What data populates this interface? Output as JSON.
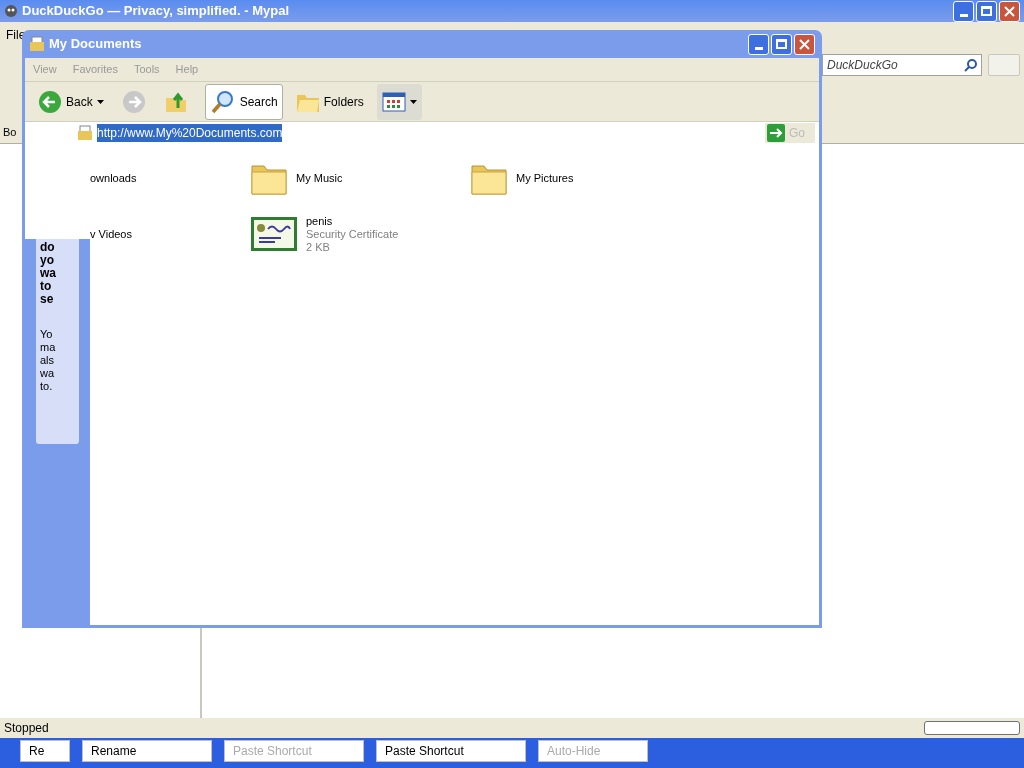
{
  "browser": {
    "title": "DuckDuckGo — Privacy, simplified. - Mypal",
    "menu": [
      "File"
    ],
    "search_placeholder": "DuckDuckGo",
    "sidebar_label": "Bo",
    "status": "Stopped"
  },
  "explorer": {
    "title": "My Documents",
    "menu": [
      "View",
      "Favorites",
      "Tools",
      "Help"
    ],
    "toolbar": [
      {
        "kind": "back",
        "label": "Back"
      },
      {
        "kind": "forward"
      },
      {
        "kind": "up"
      },
      {
        "kind": "search",
        "label": "Search",
        "selected": true
      },
      {
        "kind": "folders",
        "label": "Folders",
        "selected": false
      },
      {
        "kind": "views"
      }
    ],
    "address": "http://www.My%20Documents.com",
    "go": "Go",
    "task_pane": {
      "heading": [
        "do",
        "yo",
        "wa",
        "to",
        "se"
      ],
      "body": [
        "Yo",
        "ma",
        "als",
        "wa",
        "to."
      ]
    },
    "items": [
      {
        "kind": "cut",
        "name": "ownloads"
      },
      {
        "kind": "folder",
        "name": "My Music"
      },
      {
        "kind": "folder",
        "name": "My Pictures"
      },
      {
        "kind": "cut",
        "name": "v Videos"
      },
      {
        "kind": "certificate",
        "name": "penis",
        "type": "Security Certificate",
        "size": "2 KB"
      }
    ]
  },
  "taskbar_fragments": [
    {
      "label": "Re",
      "faded": false
    },
    {
      "label": "Rename",
      "faded": false
    },
    {
      "label": "Paste Shortcut",
      "faded": true
    },
    {
      "label": "Paste Shortcut",
      "faded": false
    },
    {
      "label": "Auto-Hide",
      "faded": true
    }
  ]
}
